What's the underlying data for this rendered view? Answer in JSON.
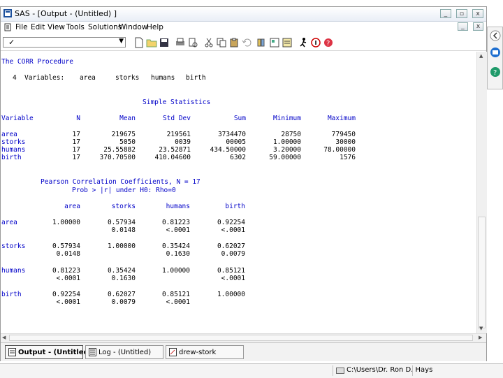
{
  "window": {
    "title": "SAS - [Output - (Untitled) ]",
    "controls": [
      "minimize-icon",
      "restore-icon",
      "close-icon"
    ]
  },
  "menu": [
    "File",
    "Edit",
    "View",
    "Tools",
    "Solutions",
    "Window",
    "Help"
  ],
  "toolbar": {
    "command_check": "✓",
    "icons": [
      "new-icon",
      "open-icon",
      "save-icon",
      "print-icon",
      "print-preview-icon",
      "cut-icon",
      "copy-icon",
      "paste-icon",
      "undo-icon",
      "libraries-icon",
      "explorer-icon",
      "results-icon",
      "run-icon",
      "info-icon",
      "help-icon"
    ]
  },
  "output": {
    "procedure": "The CORR Procedure",
    "variables_line": {
      "count": "4",
      "label": "Variables:",
      "names": [
        "area",
        "storks",
        "humans",
        "birth"
      ]
    },
    "simple_stats": {
      "title": "Simple Statistics",
      "headers": [
        "Variable",
        "N",
        "Mean",
        "Std Dev",
        "Sum",
        "Minimum",
        "Maximum"
      ],
      "rows": [
        [
          "area",
          "17",
          "219675",
          "219561",
          "3734470",
          "28750",
          "779450"
        ],
        [
          "storks",
          "17",
          "5050",
          "0039",
          "00005",
          "1.00000",
          "30000"
        ],
        [
          "humans",
          "17",
          "25.55882",
          "23.52871",
          "434.50000",
          "3.20000",
          "78.00000"
        ],
        [
          "birth",
          "17",
          "370.70500",
          "410.04600",
          "6302",
          "59.00000",
          "1576"
        ]
      ]
    },
    "pearson": {
      "title": "Pearson Correlation Coefficients, N = 17",
      "subtitle": "Prob > |r| under H0: Rho=0",
      "headers": [
        "area",
        "storks",
        "humans",
        "birth"
      ],
      "rows": [
        {
          "name": "area",
          "r": [
            "1.00000",
            "0.57934",
            "0.81223",
            "0.92254"
          ],
          "p": [
            "",
            "0.0148",
            "<.0001",
            "<.0001"
          ]
        },
        {
          "name": "storks",
          "r": [
            "0.57934",
            "1.00000",
            "0.35424",
            "0.62027"
          ],
          "p": [
            "0.0148",
            "",
            "0.1630",
            "0.0079"
          ]
        },
        {
          "name": "humans",
          "r": [
            "0.81223",
            "0.35424",
            "1.00000",
            "0.85121"
          ],
          "p": [
            "<.0001",
            "0.1630",
            "",
            "<.0001"
          ]
        },
        {
          "name": "birth",
          "r": [
            "0.92254",
            "0.62027",
            "0.85121",
            "1.00000"
          ],
          "p": [
            "<.0001",
            "0.0079",
            "<.0001",
            ""
          ]
        }
      ]
    }
  },
  "tabs": [
    "Output - (Untitled)",
    "Log - (Untitled)",
    "drew-stork"
  ],
  "status": {
    "path": "C:\\Users\\Dr. Ron D. Hays"
  },
  "colors": {
    "proc_blue": "#0000c8",
    "window_border": "#9a9a9a"
  }
}
